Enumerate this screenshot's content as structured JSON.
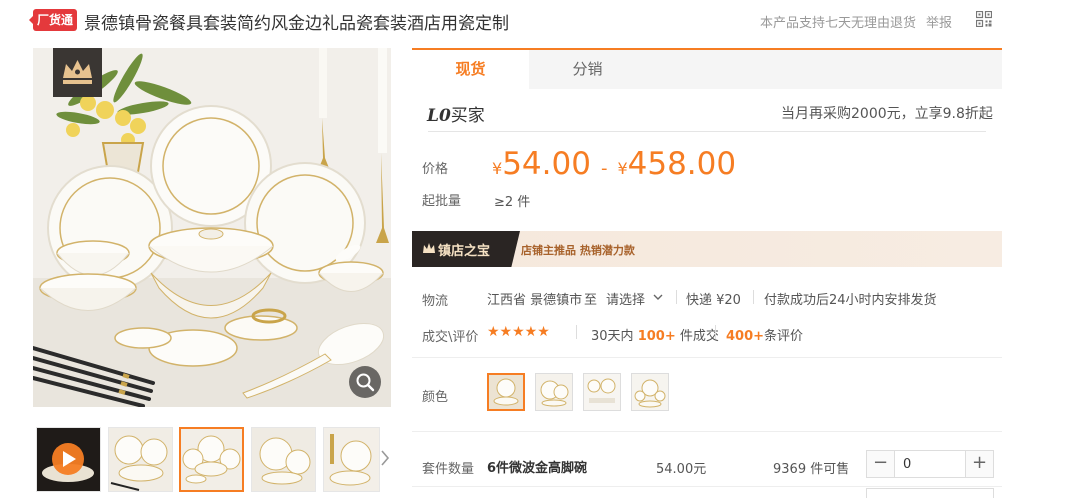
{
  "header": {
    "badge": "厂货通",
    "title": "景德镇骨瓷餐具套装简约风金边礼品瓷套装酒店用瓷定制",
    "support": "本产品支持七天无理由退货",
    "report": "举报",
    "qr_icon": "qr-code-icon"
  },
  "gallery": {
    "thumbnail_count": 5,
    "active_thumbnail": 3,
    "icons": [
      "crown-icon",
      "zoom-icon",
      "play-icon",
      "chevron-right-icon"
    ]
  },
  "tabs": [
    {
      "label": "现货",
      "active": true
    },
    {
      "label": "分销",
      "active": false
    }
  ],
  "buyer_level": {
    "level": "L0",
    "label": "买家",
    "offer": "当月再采购2000元，立享9.8折起"
  },
  "price": {
    "label": "价格",
    "currency": "¥",
    "min": "54.00",
    "dash": "-",
    "max": "458.00"
  },
  "moq": {
    "label": "起批量",
    "value": "≥2 件"
  },
  "shop_banner": {
    "left": "镇店之宝",
    "right": "店铺主推品  热销潜力款"
  },
  "logistics": {
    "label": "物流",
    "origin": "江西省 景德镇市",
    "to": "至",
    "destination": "请选择",
    "shipping": "快递 ¥20",
    "dispatch": "付款成功后24小时内安排发货"
  },
  "reviews": {
    "label": "成交\\评价",
    "stars": "★★★★★",
    "rating": 5,
    "sales_prefix": "30天内",
    "sales_count": "100+",
    "sales_suffix": "件成交",
    "review_count": "400+",
    "review_suffix": "条评价"
  },
  "color": {
    "label": "颜色",
    "swatch_count": 4,
    "active_swatch": 1
  },
  "variant": {
    "label": "套件数量",
    "name": "6件微波金高脚碗",
    "price": "54.00元",
    "stock": "9369 件可售",
    "quantity": "0",
    "minus": "−",
    "plus": "+"
  },
  "colors": {
    "accent": "#f67d23",
    "badge_red": "#e4393c",
    "banner_dark": "#2a2523",
    "banner_bg": "#f5e8dc"
  }
}
